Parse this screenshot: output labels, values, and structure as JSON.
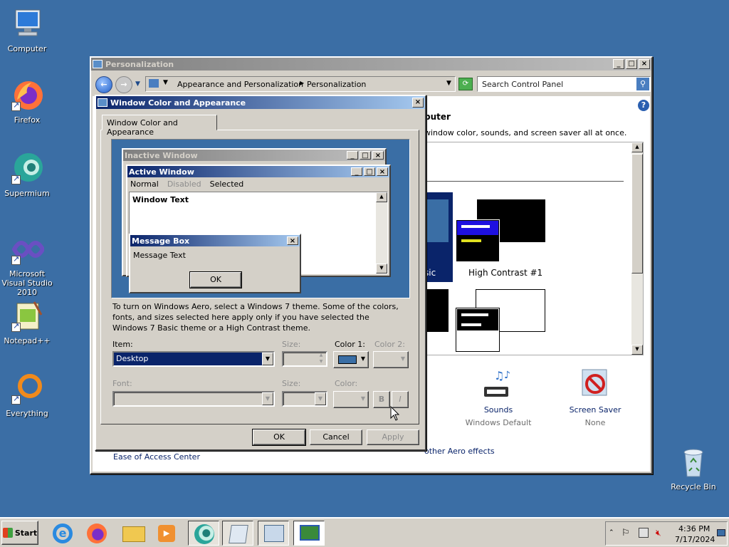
{
  "desktop_icons": [
    {
      "label": "Computer"
    },
    {
      "label": "Firefox"
    },
    {
      "label": "Supermium"
    },
    {
      "label": "Microsoft Visual Studio 2010"
    },
    {
      "label": "Notepad++"
    },
    {
      "label": "Everything"
    },
    {
      "label": "Recycle Bin"
    }
  ],
  "personalization": {
    "title": "Personalization",
    "breadcrumb": [
      "Appearance and Personalization",
      "Personalization"
    ],
    "search_placeholder": "Search Control Panel",
    "heading_fragment": "puter",
    "subtext_fragment": "window color, sounds, and screen saver all at once.",
    "theme_fragment": "sic",
    "theme_high_contrast": "High Contrast #1",
    "sounds_label": "Sounds",
    "sounds_value": "Windows Default",
    "screensaver_label": "Screen Saver",
    "screensaver_value": "None",
    "ease_link": "Ease of Access Center",
    "aero_link": "other Aero effects"
  },
  "dialog": {
    "title": "Window Color and Appearance",
    "tab": "Window Color and Appearance",
    "preview": {
      "inactive_title": "Inactive Window",
      "active_title": "Active Window",
      "menu_normal": "Normal",
      "menu_disabled": "Disabled",
      "menu_selected": "Selected",
      "window_text": "Window Text",
      "msgbox_title": "Message Box",
      "msgbox_text": "Message Text",
      "msgbox_ok": "OK"
    },
    "info": "To turn on Windows Aero, select a Windows 7 theme.  Some of the colors, fonts, and sizes selected here apply only if you have selected the Windows 7 Basic theme or a High Contrast theme.",
    "item_label": "Item:",
    "item_value": "Desktop",
    "size_label": "Size:",
    "color1_label": "Color 1:",
    "color2_label": "Color 2:",
    "font_label": "Font:",
    "font_size_label": "Size:",
    "font_color_label": "Color:",
    "bold_label": "B",
    "italic_label": "I",
    "ok_label": "OK",
    "cancel_label": "Cancel",
    "apply_label": "Apply",
    "desktop_color": "#3a6ea5"
  },
  "taskbar": {
    "start_label": "Start",
    "time": "4:36 PM",
    "date": "7/17/2024"
  },
  "colors": {
    "active_title": "#0a246a",
    "desktop": "#3b6ea5",
    "face": "#d4d0c8"
  }
}
